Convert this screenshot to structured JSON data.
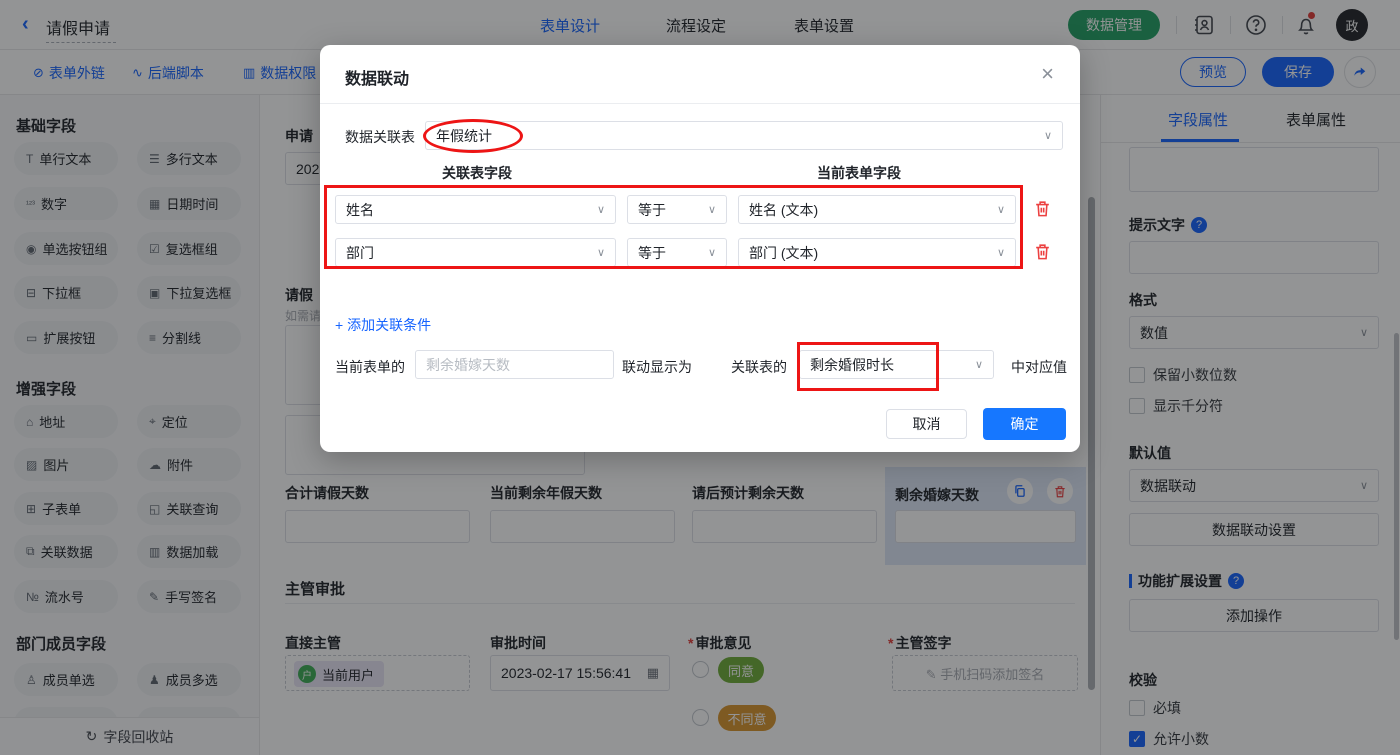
{
  "topbar": {
    "back": "‹",
    "title": "请假申请",
    "tabs": [
      {
        "label": "表单设计"
      },
      {
        "label": "流程设定"
      },
      {
        "label": "表单设置"
      }
    ],
    "data_manage": "数据管理",
    "avatar": "政"
  },
  "toolbar": {
    "items": [
      {
        "icon": "⊘",
        "label": "表单外链"
      },
      {
        "icon": "∿",
        "label": "后端脚本"
      },
      {
        "icon": "▥",
        "label": "数据权限"
      }
    ],
    "preview": "预览",
    "save": "保存"
  },
  "sidebar": {
    "groups": [
      {
        "title": "基础字段",
        "items": [
          {
            "icon": "T",
            "label": "单行文本"
          },
          {
            "icon": "☰",
            "label": "多行文本"
          },
          {
            "icon": "¹²³",
            "label": "数字"
          },
          {
            "icon": "▦",
            "label": "日期时间"
          },
          {
            "icon": "◉",
            "label": "单选按钮组"
          },
          {
            "icon": "☑",
            "label": "复选框组"
          },
          {
            "icon": "⊟",
            "label": "下拉框"
          },
          {
            "icon": "▣",
            "label": "下拉复选框"
          },
          {
            "icon": "▭",
            "label": "扩展按钮"
          },
          {
            "icon": "≡",
            "label": "分割线"
          }
        ]
      },
      {
        "title": "增强字段",
        "items": [
          {
            "icon": "⌂",
            "label": "地址"
          },
          {
            "icon": "⌖",
            "label": "定位"
          },
          {
            "icon": "▨",
            "label": "图片"
          },
          {
            "icon": "☁",
            "label": "附件"
          },
          {
            "icon": "⊞",
            "label": "子表单"
          },
          {
            "icon": "◱",
            "label": "关联查询"
          },
          {
            "icon": "⧉",
            "label": "关联数据"
          },
          {
            "icon": "▥",
            "label": "数据加载"
          },
          {
            "icon": "№",
            "label": "流水号"
          },
          {
            "icon": "✎",
            "label": "手写签名"
          }
        ]
      },
      {
        "title": "部门成员字段",
        "items": [
          {
            "icon": "♙",
            "label": "成员单选"
          },
          {
            "icon": "♟",
            "label": "成员多选"
          }
        ]
      }
    ],
    "recycle": {
      "icon": "↻",
      "label": "字段回收站"
    }
  },
  "canvas": {
    "apply_label": "申请",
    "apply_value": "202",
    "leave_label": "请假",
    "leave_hint": "如需请",
    "fields": [
      {
        "label": "合计请假天数"
      },
      {
        "label": "当前剩余年假天数"
      },
      {
        "label": "请后预计剩余天数"
      },
      {
        "label": "剩余婚嫁天数"
      }
    ],
    "section": "主管审批",
    "manager_label": "直接主管",
    "manager_tag": "当前用户",
    "manager_tag_icon": "户",
    "time_label": "审批时间",
    "time_value": "2023-02-17 15:56:41",
    "time_icon": "▦",
    "opinion_required": "*",
    "opinion_label": "审批意见",
    "agree": "同意",
    "disagree": "不同意",
    "sign_required": "*",
    "sign_label": "主管签字",
    "sign_placeholder": "✎ 手机扫码添加签名"
  },
  "panel": {
    "tab_field": "字段属性",
    "tab_form": "表单属性",
    "hint_label": "提示文字",
    "format_label": "格式",
    "format_value": "数值",
    "cb_decimal_digits": "保留小数位数",
    "cb_thousands": "显示千分符",
    "default_label": "默认值",
    "default_value": "数据联动",
    "linkage_setting_btn": "数据联动设置",
    "ext_label": "功能扩展设置",
    "add_action_btn": "添加操作",
    "validate_label": "校验",
    "cb_required": "必填",
    "cb_allow_decimal": "允许小数",
    "check_glyph": "✓"
  },
  "modal": {
    "title": "数据联动",
    "close": "×",
    "table_label": "数据关联表",
    "table_value": "年假统计",
    "col_left": "关联表字段",
    "col_right": "当前表单字段",
    "conditions": [
      {
        "left": "姓名",
        "op": "等于",
        "right": "姓名 (文本)"
      },
      {
        "left": "部门",
        "op": "等于",
        "right": "部门 (文本)"
      }
    ],
    "add_condition": "+ 添加关联条件",
    "current_label": "当前表单的",
    "current_placeholder": "剩余婚嫁天数",
    "display_as": "联动显示为",
    "related_label": "关联表的",
    "related_value": "剩余婚假时长",
    "suffix": "中对应值",
    "cancel": "取消",
    "confirm": "确定"
  },
  "colors": {
    "primary": "#1664ff",
    "confirm": "#1677ff",
    "annotation": "#ed1515",
    "green": "#23a164"
  }
}
